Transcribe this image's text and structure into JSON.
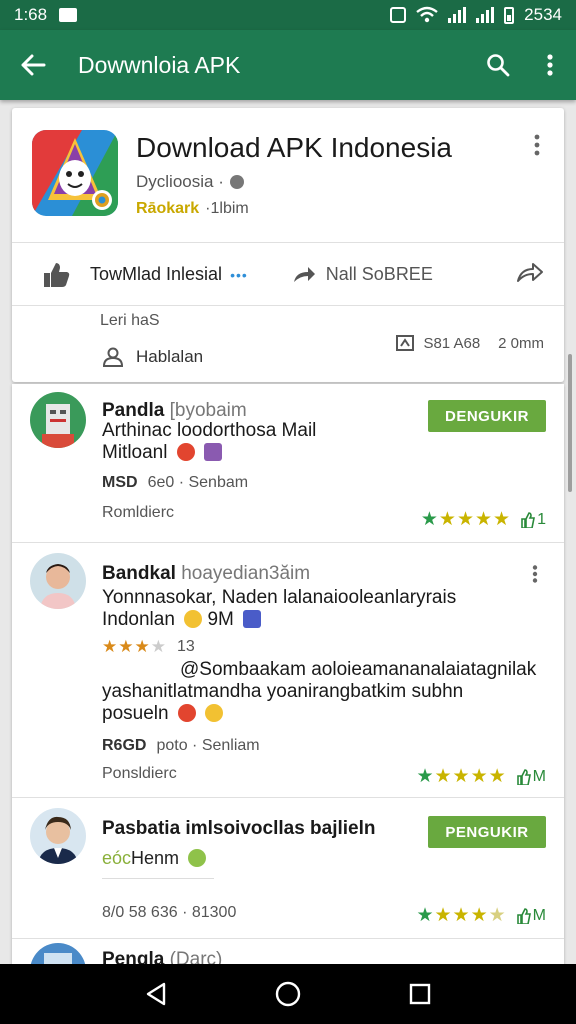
{
  "status_bar": {
    "time": "1:68",
    "battery": "2534"
  },
  "app_bar": {
    "title": "Dowwnloia APK"
  },
  "app_card": {
    "title": "Download APK Indonesia",
    "developer": "Dyclioosia ·",
    "rank_label": "Rāokark",
    "rank_value": "·1lbim",
    "action_left_label": "TowMlad Inlesial",
    "action_left_dots": "•••",
    "action_mid_label": "Nall SoBREE",
    "size_label": "Leri haS",
    "size_value": "S81 A68",
    "size_extra": "2 0mm",
    "permission_label": "Hablalan"
  },
  "reviews": [
    {
      "name": "Pandla",
      "handle": "[byobaim",
      "text_line1": "Arthinac loodorthosa Mail",
      "text_line2": "Mitloanl",
      "meta_bold": "MSD",
      "meta_mid": "6e0",
      "meta_right": "Senbam",
      "footer": "Romldierc",
      "button": "DENGUKIR",
      "stars_green": 1,
      "stars_yellow": 4,
      "stars_empty": 0,
      "thumb_count": "1"
    },
    {
      "name": "Bandkal",
      "handle": "hoayedian3ăim",
      "text_line1": "Yonnnasokar, Naden lalanaiooleanlaryrais",
      "text_line2": "Indonlan",
      "text_after_emoji": "9M",
      "rating_count": "13",
      "body_line1": "@Sombaakam aoloieamananalaiatagnilak",
      "body_line2": "yashanitlatmandha yoanirangbatkim subhn",
      "body_line3": "posueln",
      "meta_bold": "R6GD",
      "meta_mid": "poto",
      "meta_right": "Senliam",
      "footer": "Ponsldierc",
      "stars_green": 1,
      "stars_yellow": 4,
      "stars_empty": 0,
      "thumb_count": "M"
    },
    {
      "name": "Pasbatia imlsoivocllas bajlieln",
      "tag_hl": "eóc",
      "tag_rest": "Henm",
      "meta_line": "8/0 58  636 ·  81300",
      "button": "PENGUKIR",
      "stars_green": 1,
      "stars_yellow": 3,
      "stars_empty": 1,
      "thumb_count": "M"
    },
    {
      "name": "Pengla",
      "handle": "(Darc)"
    }
  ],
  "colors": {
    "app_bar": "#1e7b51",
    "status_bar": "#1b6b46",
    "install_button": "#69a93f",
    "star_green": "#2a9a4a",
    "star_yellow": "#c9b400"
  }
}
